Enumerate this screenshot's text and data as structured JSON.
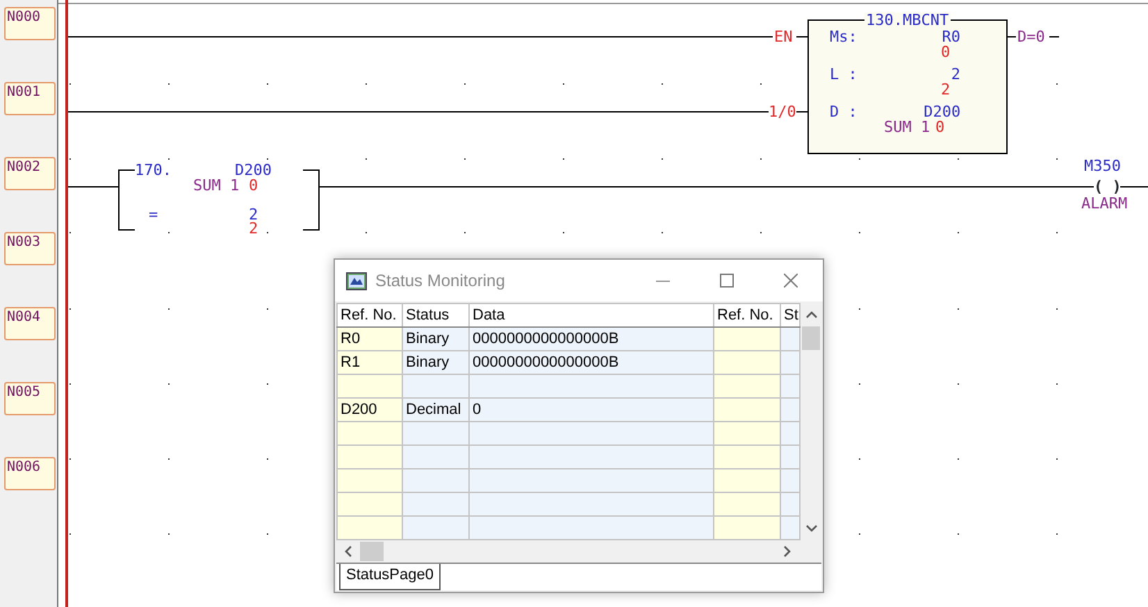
{
  "networks": [
    {
      "label": "N000"
    },
    {
      "label": "N001"
    },
    {
      "label": "N002"
    },
    {
      "label": "N003"
    },
    {
      "label": "N004"
    },
    {
      "label": "N005"
    },
    {
      "label": "N006"
    }
  ],
  "function_block": {
    "title": "130.MBCNT",
    "inputs": [
      {
        "label": "EN"
      },
      {
        "label": "1/0"
      }
    ],
    "output": "D=0",
    "params": [
      {
        "name": "Ms:",
        "operand": "R0",
        "current": "0"
      },
      {
        "name": "L :",
        "operand": "2",
        "current": "2"
      },
      {
        "name": "D :",
        "operand": "D200",
        "comment": "SUM 1",
        "current": "0"
      }
    ]
  },
  "compare_block": {
    "number": "170.",
    "operand": "D200",
    "comment": "SUM 1",
    "current": "0",
    "operator": "=",
    "value": "2",
    "value_current": "2"
  },
  "coil": {
    "address": "M350",
    "symbol": "( )",
    "comment": "ALARM"
  },
  "status_window": {
    "title": "Status Monitoring",
    "columns": [
      "Ref. No.",
      "Status",
      "Data",
      "Ref. No.",
      "St"
    ],
    "rows": [
      {
        "ref": "R0",
        "status": "Binary",
        "data": "0000000000000000B"
      },
      {
        "ref": "R1",
        "status": "Binary",
        "data": "0000000000000000B"
      },
      {},
      {
        "ref": "D200",
        "status": "Decimal",
        "data": "0"
      },
      {},
      {},
      {},
      {},
      {}
    ],
    "tabs": [
      {
        "label": "StatusPage0",
        "selected": true
      }
    ]
  }
}
